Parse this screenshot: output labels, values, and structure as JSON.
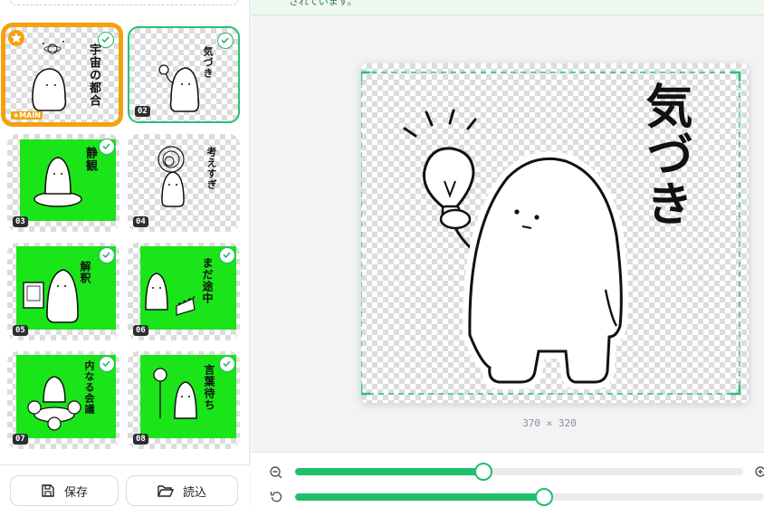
{
  "notice": {
    "text": "されています。"
  },
  "stickers": [
    {
      "label": "宇宙の都合",
      "badge": "★MAIN",
      "background": "checker",
      "main": true
    },
    {
      "label": "気づき",
      "number": "02",
      "background": "checker",
      "selected": true
    },
    {
      "label": "静観",
      "number": "03",
      "background": "green"
    },
    {
      "label": "考えすぎ",
      "number": "04",
      "background": "checker"
    },
    {
      "label": "解釈",
      "number": "05",
      "background": "green"
    },
    {
      "label": "まだ途中",
      "number": "06",
      "background": "green"
    },
    {
      "label": "内なる会議",
      "number": "07",
      "background": "green"
    },
    {
      "label": "言葉待ち",
      "number": "08",
      "background": "green"
    }
  ],
  "footer": {
    "save_label": "保存",
    "load_label": "読込"
  },
  "preview": {
    "text": "気づき",
    "size": "370 × 320"
  },
  "sliders": {
    "zoom_value": 0.42,
    "rotate_value": 0.53
  },
  "icons": [
    "star-icon",
    "check-icon",
    "save-icon",
    "folder-open-icon",
    "zoom-out-icon",
    "zoom-in-icon",
    "rotate-icon"
  ],
  "colors": {
    "accent": "#1fbf6b",
    "main_badge": "#f5a10f",
    "sticker_green": "#19e519"
  }
}
